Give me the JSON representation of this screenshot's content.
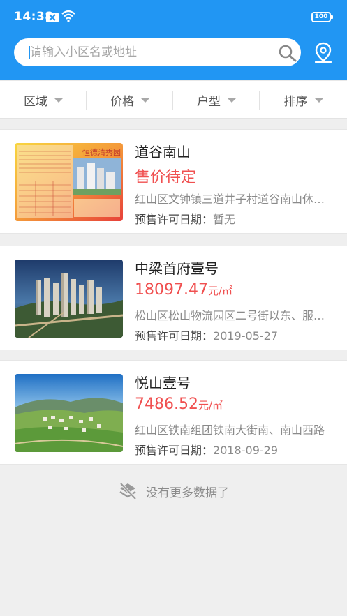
{
  "status_bar": {
    "time": "14:38",
    "battery": "100"
  },
  "search": {
    "placeholder": "请输入小区名或地址"
  },
  "filters": [
    {
      "label": "区域"
    },
    {
      "label": "价格"
    },
    {
      "label": "户型"
    },
    {
      "label": "排序"
    }
  ],
  "listings": [
    {
      "name": "道谷南山",
      "price": "售价待定",
      "unit": "",
      "address": "红山区文钟镇三道井子村道谷南山休闲度假区",
      "permit_label": "预售许可日期：",
      "permit_date": "暂无",
      "thumb_text": "恒德清秀园"
    },
    {
      "name": "中梁首府壹号",
      "price": "18097.47",
      "unit": "元/㎡",
      "address": "松山区松山物流园区二号街以东、服务区",
      "permit_label": "预售许可日期：",
      "permit_date": "2019-05-27"
    },
    {
      "name": "悦山壹号",
      "price": "7486.52",
      "unit": "元/㎡",
      "address": "红山区铁南组团铁南大街南、南山西路",
      "permit_label": "预售许可日期：",
      "permit_date": "2018-09-29"
    }
  ],
  "footer": {
    "no_more": "没有更多数据了"
  },
  "colors": {
    "primary": "#2196f3",
    "price": "#f05050"
  }
}
